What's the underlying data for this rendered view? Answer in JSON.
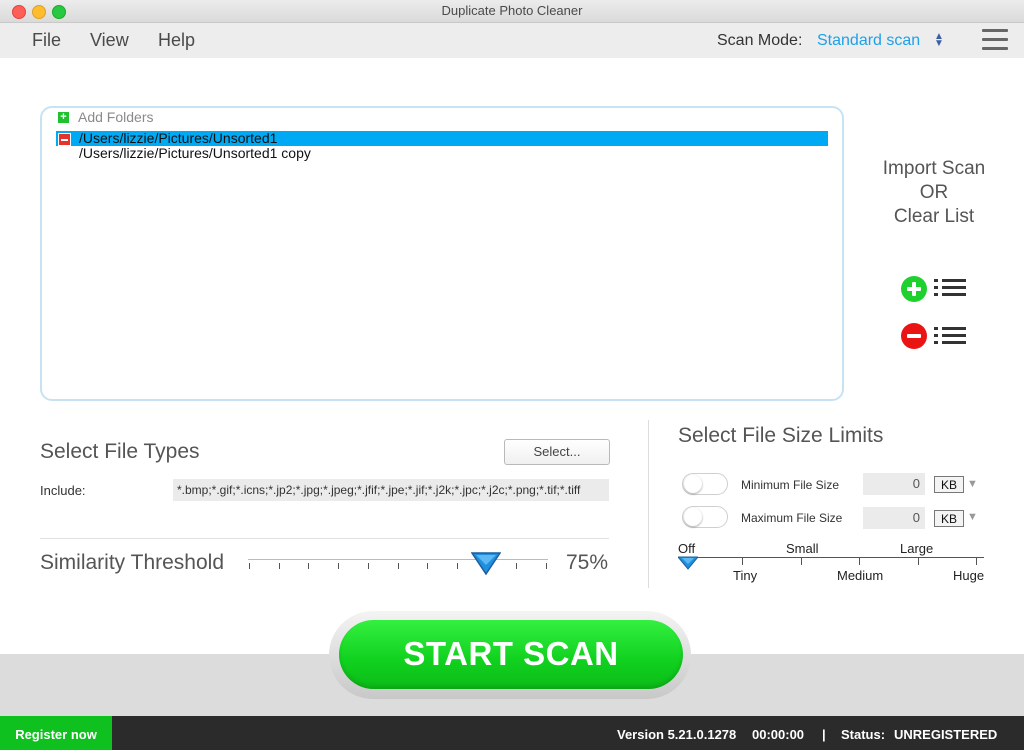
{
  "window": {
    "title": "Duplicate Photo Cleaner"
  },
  "menu": {
    "file": "File",
    "view": "View",
    "help": "Help"
  },
  "scan_mode": {
    "label": "Scan Mode:",
    "value": "Standard scan"
  },
  "folders": {
    "add_label": "Add Folders",
    "items": [
      {
        "path": "/Users/lizzie/Pictures/Unsorted1",
        "selected": true
      },
      {
        "path": "/Users/lizzie/Pictures/Unsorted1 copy",
        "selected": false
      }
    ]
  },
  "import": {
    "line1": "Import Scan",
    "line2": "OR",
    "line3": "Clear List"
  },
  "file_types": {
    "title": "Select File Types",
    "select_button": "Select...",
    "include_label": "Include:",
    "include_value": "*.bmp;*.gif;*.icns;*.jp2;*.jpg;*.jpeg;*.jfif;*.jpe;*.jif;*.j2k;*.jpc;*.j2c;*.png;*.tif;*.tiff"
  },
  "similarity": {
    "title": "Similarity Threshold",
    "value_label": "75%",
    "value": 0.75
  },
  "file_size": {
    "title": "Select File Size Limits",
    "min": {
      "label": "Minimum File Size",
      "value": "0",
      "unit": "KB",
      "enabled": false
    },
    "max": {
      "label": "Maximum File Size",
      "value": "0",
      "unit": "KB",
      "enabled": false
    },
    "scale_top": [
      "Off",
      "Small",
      "Large"
    ],
    "scale_bottom": [
      "Tiny",
      "Medium",
      "Huge"
    ],
    "selected": "Off"
  },
  "start_button": "START SCAN",
  "status": {
    "register": "Register now",
    "version": "Version 5.21.0.1278",
    "time": "00:00:00",
    "separator": "|",
    "status_label": "Status:",
    "status_value": "UNREGISTERED"
  },
  "colors": {
    "accent_blue": "#00a9f4",
    "green": "#10d01e",
    "red": "#e4322c",
    "link_blue": "#1ea0e8"
  }
}
